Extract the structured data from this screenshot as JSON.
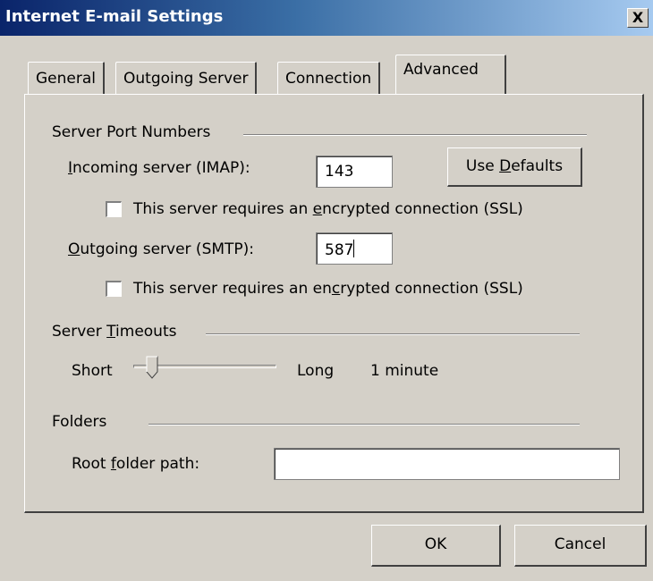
{
  "window": {
    "title": "Internet E-mail Settings",
    "close_glyph": "X"
  },
  "tabs": [
    {
      "label": "General",
      "active": false
    },
    {
      "label": "Outgoing Server",
      "active": false
    },
    {
      "label": "Connection",
      "active": false
    },
    {
      "label": "Advanced",
      "active": true
    }
  ],
  "server_ports": {
    "group_label": "Server Port Numbers",
    "incoming_label_mn": "I",
    "incoming_label_rest": "ncoming server (IMAP):",
    "incoming_value": "143",
    "use_defaults_pre": "Use ",
    "use_defaults_mn": "D",
    "use_defaults_post": "efaults",
    "incoming_ssl_pre": "This server requires an ",
    "incoming_ssl_mn": "e",
    "incoming_ssl_post": "ncrypted connection (SSL)",
    "incoming_ssl_checked": false,
    "outgoing_label_mn": "O",
    "outgoing_label_rest": "utgoing server (SMTP):",
    "outgoing_value": "587",
    "outgoing_ssl_pre": "This server requires an en",
    "outgoing_ssl_mn": "c",
    "outgoing_ssl_post": "rypted connection (SSL)",
    "outgoing_ssl_checked": false
  },
  "timeouts": {
    "group_label_pre": "Server ",
    "group_label_mn": "T",
    "group_label_post": "imeouts",
    "short_label": "Short",
    "long_label": "Long",
    "value_label": "1 minute",
    "slider_fraction": 0.1
  },
  "folders": {
    "group_label": "Folders",
    "root_label_pre": "Root ",
    "root_label_mn": "f",
    "root_label_post": "older path:",
    "root_value": ""
  },
  "footer": {
    "ok_label": "OK",
    "cancel_label": "Cancel"
  },
  "colors": {
    "face": "#d4d0c8",
    "title_start": "#0a246a",
    "title_end": "#a6caf0"
  }
}
